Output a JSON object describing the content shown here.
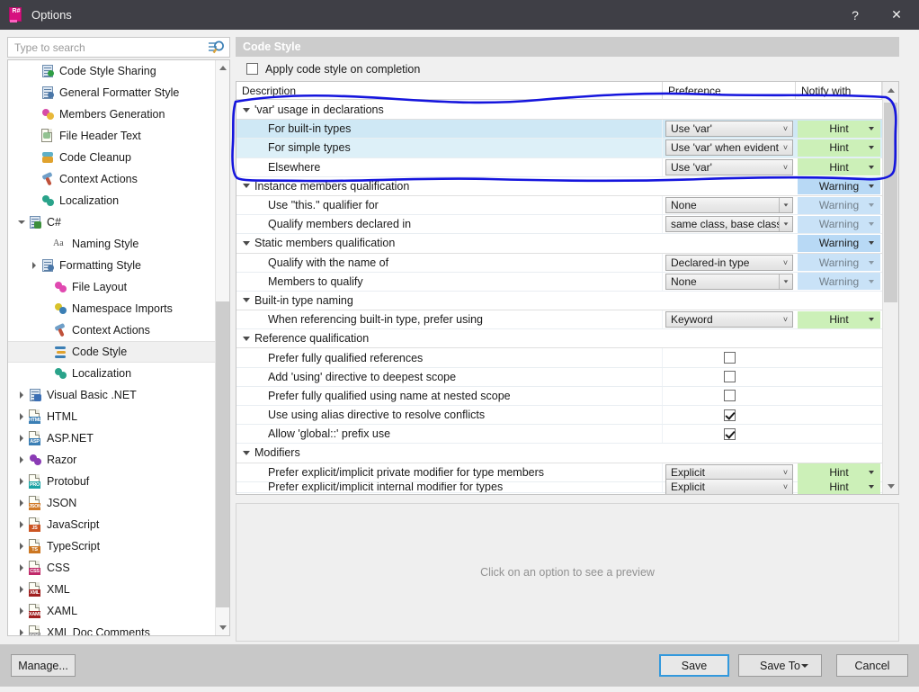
{
  "window": {
    "title": "Options",
    "app_icon": "resharper-icon",
    "help_label": "?",
    "close_label": "✕"
  },
  "search": {
    "placeholder": "Type to search",
    "value": "",
    "icon": "search-icon"
  },
  "sidebar": {
    "items": [
      {
        "label": "Code Style Sharing",
        "indent": 1,
        "arrow": "none",
        "icon": "code-style-sharing-icon",
        "selected": false
      },
      {
        "label": "General Formatter Style",
        "indent": 1,
        "arrow": "none",
        "icon": "formatter-style-icon",
        "selected": false
      },
      {
        "label": "Members Generation",
        "indent": 1,
        "arrow": "none",
        "icon": "members-generation-icon",
        "selected": false
      },
      {
        "label": "File Header Text",
        "indent": 1,
        "arrow": "none",
        "icon": "file-header-icon",
        "selected": false
      },
      {
        "label": "Code Cleanup",
        "indent": 1,
        "arrow": "none",
        "icon": "code-cleanup-icon",
        "selected": false
      },
      {
        "label": "Context Actions",
        "indent": 1,
        "arrow": "none",
        "icon": "context-actions-icon",
        "selected": false
      },
      {
        "label": "Localization",
        "indent": 1,
        "arrow": "none",
        "icon": "localization-icon",
        "selected": false
      },
      {
        "label": "C#",
        "indent": 0,
        "arrow": "expanded",
        "icon": "csharp-icon",
        "selected": false
      },
      {
        "label": "Naming Style",
        "indent": 2,
        "arrow": "none",
        "icon": "naming-style-icon",
        "selected": false
      },
      {
        "label": "Formatting Style",
        "indent": 1,
        "arrow": "collapsed",
        "icon": "formatting-style-icon",
        "selected": false
      },
      {
        "label": "File Layout",
        "indent": 2,
        "arrow": "none",
        "icon": "file-layout-icon",
        "selected": false
      },
      {
        "label": "Namespace Imports",
        "indent": 2,
        "arrow": "none",
        "icon": "namespace-imports-icon",
        "selected": false
      },
      {
        "label": "Context Actions",
        "indent": 2,
        "arrow": "none",
        "icon": "context-actions-icon",
        "selected": false
      },
      {
        "label": "Code Style",
        "indent": 2,
        "arrow": "none",
        "icon": "code-style-icon",
        "selected": true
      },
      {
        "label": "Localization",
        "indent": 2,
        "arrow": "none",
        "icon": "localization-icon",
        "selected": false
      },
      {
        "label": "Visual Basic .NET",
        "indent": 0,
        "arrow": "collapsed",
        "icon": "vb-net-icon",
        "selected": false
      },
      {
        "label": "HTML",
        "indent": 0,
        "arrow": "collapsed",
        "icon": "html-icon",
        "selected": false
      },
      {
        "label": "ASP.NET",
        "indent": 0,
        "arrow": "collapsed",
        "icon": "aspnet-icon",
        "selected": false
      },
      {
        "label": "Razor",
        "indent": 0,
        "arrow": "collapsed",
        "icon": "razor-icon",
        "selected": false
      },
      {
        "label": "Protobuf",
        "indent": 0,
        "arrow": "collapsed",
        "icon": "protobuf-icon",
        "selected": false
      },
      {
        "label": "JSON",
        "indent": 0,
        "arrow": "collapsed",
        "icon": "json-icon",
        "selected": false
      },
      {
        "label": "JavaScript",
        "indent": 0,
        "arrow": "collapsed",
        "icon": "javascript-icon",
        "selected": false
      },
      {
        "label": "TypeScript",
        "indent": 0,
        "arrow": "collapsed",
        "icon": "typescript-icon",
        "selected": false
      },
      {
        "label": "CSS",
        "indent": 0,
        "arrow": "collapsed",
        "icon": "css-icon",
        "selected": false
      },
      {
        "label": "XML",
        "indent": 0,
        "arrow": "collapsed",
        "icon": "xml-icon",
        "selected": false
      },
      {
        "label": "XAML",
        "indent": 0,
        "arrow": "collapsed",
        "icon": "xaml-icon",
        "selected": false
      },
      {
        "label": "XML Doc Comments",
        "indent": 0,
        "arrow": "collapsed",
        "icon": "xml-doc-comments-icon",
        "selected": false
      }
    ]
  },
  "page": {
    "header": "Code Style",
    "apply_on_completion": {
      "label": "Apply code style on completion",
      "checked": false
    }
  },
  "grid": {
    "columns": [
      "Description",
      "Preference",
      "Notify with"
    ],
    "rows": [
      {
        "type": "group",
        "desc": "'var' usage in declarations",
        "preference": null,
        "notify": null,
        "notify_style": "none"
      },
      {
        "type": "option",
        "desc": "For built-in types",
        "preference": "Use 'var'",
        "notify": "Hint",
        "notify_style": "hint",
        "selected": "strong"
      },
      {
        "type": "option",
        "desc": "For simple types",
        "preference": "Use 'var' when evident",
        "notify": "Hint",
        "notify_style": "hint",
        "selected": "light"
      },
      {
        "type": "option",
        "desc": "Elsewhere",
        "preference": "Use 'var'",
        "notify": "Hint",
        "notify_style": "hint"
      },
      {
        "type": "group",
        "desc": "Instance members qualification",
        "preference": null,
        "notify": "Warning",
        "notify_style": "warning"
      },
      {
        "type": "option",
        "desc": "Use \"this.\" qualifier for",
        "preference": "None",
        "notify": "Warning",
        "notify_style": "warning-dim",
        "combo_split": true
      },
      {
        "type": "option",
        "desc": "Qualify members declared in",
        "preference": "same class, base class",
        "notify": "Warning",
        "notify_style": "warning-dim",
        "combo_split": true
      },
      {
        "type": "group",
        "desc": "Static members qualification",
        "preference": null,
        "notify": "Warning",
        "notify_style": "warning"
      },
      {
        "type": "option",
        "desc": "Qualify with the name of",
        "preference": "Declared-in type",
        "notify": "Warning",
        "notify_style": "warning-dim"
      },
      {
        "type": "option",
        "desc": "Members to qualify",
        "preference": "None",
        "notify": "Warning",
        "notify_style": "warning-dim",
        "combo_split": true
      },
      {
        "type": "group",
        "desc": "Built-in type naming",
        "preference": null,
        "notify": null,
        "notify_style": "none"
      },
      {
        "type": "option",
        "desc": "When referencing built-in type, prefer using",
        "preference": "Keyword",
        "notify": "Hint",
        "notify_style": "hint"
      },
      {
        "type": "group",
        "desc": "Reference qualification",
        "preference": null,
        "notify": null,
        "notify_style": "none"
      },
      {
        "type": "check",
        "desc": "Prefer fully qualified references",
        "checked": false
      },
      {
        "type": "check",
        "desc": "Add 'using' directive to deepest scope",
        "checked": false
      },
      {
        "type": "check",
        "desc": "Prefer fully qualified using name at nested scope",
        "checked": false
      },
      {
        "type": "check",
        "desc": "Use using alias directive to resolve conflicts",
        "checked": true
      },
      {
        "type": "check",
        "desc": "Allow 'global::' prefix use",
        "checked": true
      },
      {
        "type": "group",
        "desc": "Modifiers",
        "preference": null,
        "notify": null,
        "notify_style": "none"
      },
      {
        "type": "option",
        "desc": "Prefer explicit/implicit private modifier for type members",
        "preference": "Explicit",
        "notify": "Hint",
        "notify_style": "hint"
      },
      {
        "type": "option",
        "desc": "Prefer explicit/implicit internal modifier for types",
        "preference": "Explicit",
        "notify": "Hint",
        "notify_style": "hint",
        "clipped": true
      }
    ]
  },
  "preview": {
    "placeholder": "Click on an option to see a preview"
  },
  "footer": {
    "manage": "Manage...",
    "save": "Save",
    "save_to": "Save To",
    "cancel": "Cancel"
  },
  "annotation": {
    "color": "#1515dd",
    "shape": "hand-drawn-ellipse-around-var-usage-rows"
  }
}
